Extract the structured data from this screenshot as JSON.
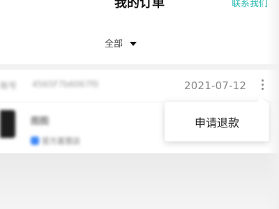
{
  "header": {
    "title": "我的订单",
    "contact_label": "联系我们"
  },
  "filter": {
    "selected": "全部"
  },
  "order": {
    "shop_label": "账号",
    "order_no": "4565F7b6067f0",
    "date": "2021-07-12",
    "product_name": "图图",
    "tag_text": "官方直营店"
  },
  "popover": {
    "refund_label": "申请退款"
  },
  "colors": {
    "accent": "#23b7b0",
    "tag": "#3d86f6"
  }
}
